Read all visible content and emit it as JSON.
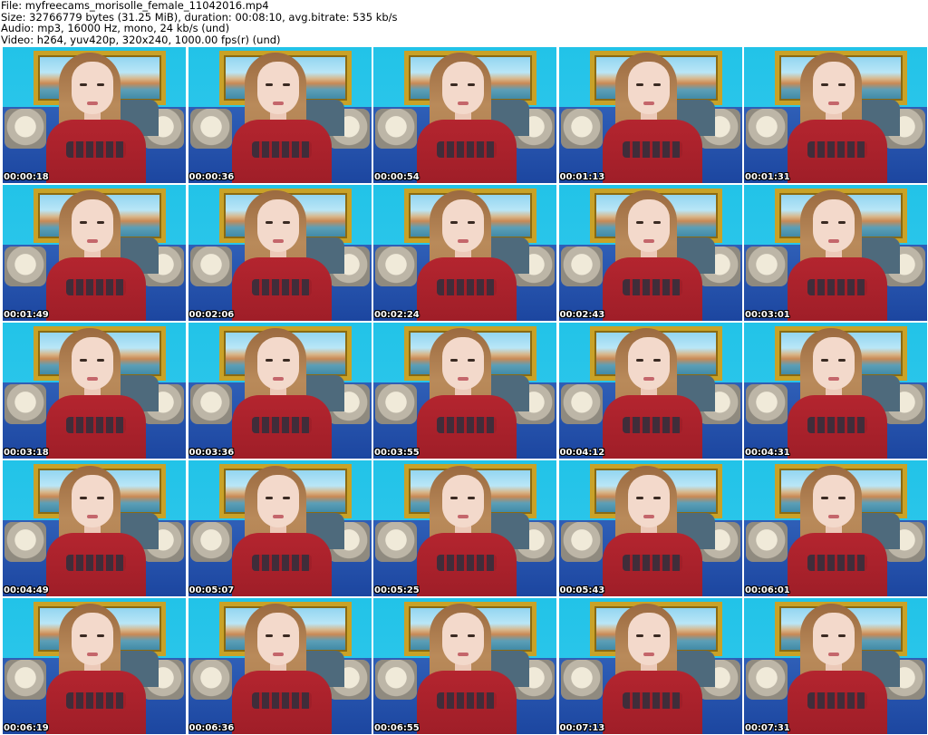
{
  "header": {
    "file_line": "File: myfreecams_morisolle_female_11042016.mp4",
    "size_line": "Size: 32766779 bytes (31.25 MiB), duration: 00:08:10, avg.bitrate: 535 kb/s",
    "audio_line": "Audio: mp3, 16000 Hz, mono, 24 kb/s (und)",
    "video_line": "Video: h264, yuv420p, 320x240, 1000.00 fps(r) (und)"
  },
  "thumbnails": [
    {
      "timestamp": "00:00:18"
    },
    {
      "timestamp": "00:00:36"
    },
    {
      "timestamp": "00:00:54"
    },
    {
      "timestamp": "00:01:13"
    },
    {
      "timestamp": "00:01:31"
    },
    {
      "timestamp": "00:01:49"
    },
    {
      "timestamp": "00:02:06"
    },
    {
      "timestamp": "00:02:24"
    },
    {
      "timestamp": "00:02:43"
    },
    {
      "timestamp": "00:03:01"
    },
    {
      "timestamp": "00:03:18"
    },
    {
      "timestamp": "00:03:36"
    },
    {
      "timestamp": "00:03:55"
    },
    {
      "timestamp": "00:04:12"
    },
    {
      "timestamp": "00:04:31"
    },
    {
      "timestamp": "00:04:49"
    },
    {
      "timestamp": "00:05:07"
    },
    {
      "timestamp": "00:05:25"
    },
    {
      "timestamp": "00:05:43"
    },
    {
      "timestamp": "00:06:01"
    },
    {
      "timestamp": "00:06:19"
    },
    {
      "timestamp": "00:06:36"
    },
    {
      "timestamp": "00:06:55"
    },
    {
      "timestamp": "00:07:13"
    },
    {
      "timestamp": "00:07:31"
    }
  ],
  "colors": {
    "background": "#ffffff",
    "wall": "#27c4e4",
    "frame_gold": "#c9a227",
    "shirt_red": "#b4252f",
    "timestamp_text": "#ffffff"
  }
}
